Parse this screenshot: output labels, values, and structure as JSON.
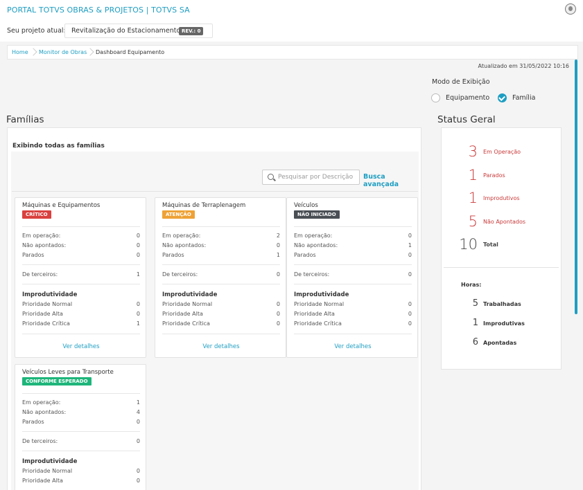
{
  "header": {
    "title": "PORTAL TOTVS OBRAS & PROJETOS | TOTVS SA"
  },
  "project": {
    "label": "Seu projeto atual:",
    "name": "Revitalização do Estacionamento",
    "rev": "REV.: 0"
  },
  "breadcrumb": [
    "Home",
    "Monitor de Obras",
    "Dashboard Equipamento"
  ],
  "updated": "Atualizado em 31/05/2022 10:16",
  "view_mode": {
    "title": "Modo de Exibição",
    "options": [
      "Equipamento",
      "Família"
    ],
    "selected": "Família"
  },
  "families": {
    "title": "Famílias",
    "subtitle": "Exibindo todas as famílias",
    "search_placeholder": "Pesquisar por Descrição",
    "advanced_search": "Busca avançada",
    "labels": {
      "em_operacao": "Em operação:",
      "nao_apontados": "Não apontados:",
      "parados": "Parados",
      "terceiros": "De terceiros:",
      "improdutividade": "Improdutividade",
      "prio_normal": "Prioridade Normal",
      "prio_alta": "Prioridade Alta",
      "prio_critica": "Prioridade Crítica",
      "details": "Ver detalhes"
    },
    "cards": [
      {
        "name": "Máquinas e Equipamentos",
        "status": "CRÍTICO",
        "status_color": "#d9413f",
        "em_operacao": "0",
        "nao_apontados": "0",
        "parados": "0",
        "terceiros": "1",
        "prio_normal": "0",
        "prio_alta": "0",
        "prio_critica": "1"
      },
      {
        "name": "Máquinas de Terraplenagem",
        "status": "ATENÇÃO",
        "status_color": "#eea236",
        "em_operacao": "2",
        "nao_apontados": "0",
        "parados": "1",
        "terceiros": "0",
        "prio_normal": "0",
        "prio_alta": "0",
        "prio_critica": "0"
      },
      {
        "name": "Veículos",
        "status": "NÃO INICIADO",
        "status_color": "#4a4f55",
        "em_operacao": "0",
        "nao_apontados": "1",
        "parados": "0",
        "terceiros": "0",
        "prio_normal": "0",
        "prio_alta": "0",
        "prio_critica": "0"
      },
      {
        "name": "Veículos Leves para Transporte",
        "status": "CONFORME ESPERADO",
        "status_color": "#1eb57a",
        "em_operacao": "1",
        "nao_apontados": "4",
        "parados": "0",
        "terceiros": "0",
        "prio_normal": "0",
        "prio_alta": "0"
      }
    ]
  },
  "status_geral": {
    "title": "Status Geral",
    "stats": [
      {
        "value": "3",
        "label": "Em Operação"
      },
      {
        "value": "1",
        "label": "Parados"
      },
      {
        "value": "1",
        "label": "Improdutivos"
      },
      {
        "value": "5",
        "label": "Não Apontados"
      },
      {
        "value": "10",
        "label": "Total"
      }
    ],
    "hours_label": "Horas:",
    "hours": [
      {
        "value": "5",
        "label": "Trabalhadas"
      },
      {
        "value": "1",
        "label": "Improdutivas"
      },
      {
        "value": "6",
        "label": "Apontadas"
      }
    ]
  }
}
